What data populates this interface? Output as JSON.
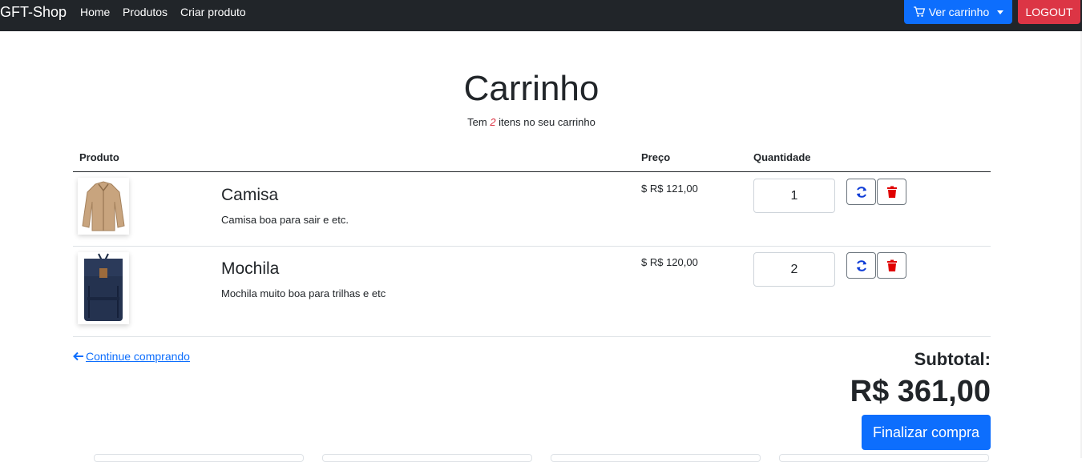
{
  "navbar": {
    "brand": "GFT-Shop",
    "links": [
      "Home",
      "Produtos",
      "Criar produto"
    ],
    "cart_button": "Ver carrinho",
    "logout_button": "LOGOUT"
  },
  "page": {
    "title": "Carrinho",
    "subtitle_prefix": "Tem ",
    "item_count": "2",
    "subtitle_suffix": " itens no seu carrinho"
  },
  "table": {
    "headers": {
      "product": "Produto",
      "price": "Preço",
      "quantity": "Quantidade"
    },
    "rows": [
      {
        "name": "Camisa",
        "description": "Camisa boa para sair e etc.",
        "price": "$ R$ 121,00",
        "quantity": "1"
      },
      {
        "name": "Mochila",
        "description": "Mochila muito boa para trilhas e etc",
        "price": "$ R$ 120,00",
        "quantity": "2"
      }
    ]
  },
  "footer": {
    "continue_link": " Continue comprando",
    "subtotal_label": "Subtotal:",
    "subtotal_value": "R$ 361,00",
    "finish_button": "Finalizar compra"
  },
  "colors": {
    "primary": "#0d6efd",
    "danger": "#dc3545",
    "navbar": "#212529"
  }
}
